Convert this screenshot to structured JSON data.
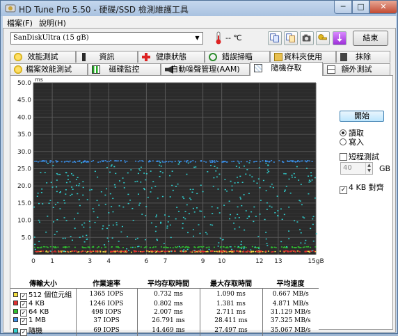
{
  "window": {
    "title": "HD Tune Pro 5.50 - 硬碟/SSD 檢測維護工具",
    "min": "─",
    "max": "□",
    "close": "✕"
  },
  "menu": [
    "檔案(F)",
    "說明(H)"
  ],
  "toolbar": {
    "drive": "SanDiskUltra (15 gB)",
    "temperature": "-- ℃",
    "exit": "結束",
    "icons": [
      "copy-icon",
      "copy-info-icon",
      "camera-icon",
      "settings-key-icon",
      "save-icon"
    ]
  },
  "tabs_top": [
    "效能測試",
    "資訊",
    "健康狀態",
    "錯誤掃瞄",
    "資料夾使用",
    "抹除"
  ],
  "tabs_bottom": [
    "檔案效能測試",
    "磁碟監控",
    "自動噪聲管理(AAM)",
    "隨機存取",
    "額外測試"
  ],
  "active_tab": "隨機存取",
  "controls": {
    "start": "開始",
    "read": "讀取",
    "write": "寫入",
    "short_test": "短程測試",
    "gb_value": "40",
    "gb_unit": "GB",
    "align": "4 KB 對齊"
  },
  "chart_data": {
    "type": "scatter",
    "ylabel": "ms",
    "xlabel_unit": "gB",
    "ylim": [
      0,
      50
    ],
    "xlim": [
      0,
      15
    ],
    "y_ticks": [
      "50.0",
      "45.0",
      "40.0",
      "35.0",
      "30.0",
      "25.0",
      "20.0",
      "15.0",
      "10.0",
      "5.0"
    ],
    "x_ticks": [
      "0",
      "1",
      "3",
      "4",
      "6",
      "7",
      "9",
      "10",
      "12",
      "13",
      "15gB"
    ],
    "grid": true,
    "series": [
      {
        "name": "512 個位元組",
        "color": "#f5e040",
        "avg_ms": 0.732
      },
      {
        "name": "4 KB",
        "color": "#e03030",
        "avg_ms": 0.802
      },
      {
        "name": "64 KB",
        "color": "#30c030",
        "avg_ms": 2.007
      },
      {
        "name": "1 MB",
        "color": "#3a8fe8",
        "avg_ms": 26.791
      },
      {
        "name": "隨機",
        "color": "#30d0d0",
        "avg_ms": 14.469
      }
    ]
  },
  "results": {
    "headers": [
      "傳輸大小",
      "作業速率",
      "平均存取時間",
      "最大存取時間",
      "平均速度"
    ],
    "rows": [
      {
        "label": "512 個位元組",
        "color": "#f5e040",
        "iops": "1365 IOPS",
        "avg": "0.732 ms",
        "max": "1.090 ms",
        "speed": "0.667 MB/s"
      },
      {
        "label": "4 KB",
        "color": "#e03030",
        "iops": "1246 IOPS",
        "avg": "0.802 ms",
        "max": "1.381 ms",
        "speed": "4.871 MB/s"
      },
      {
        "label": "64 KB",
        "color": "#30c030",
        "iops": "498 IOPS",
        "avg": "2.007 ms",
        "max": "2.711 ms",
        "speed": "31.129 MB/s"
      },
      {
        "label": "1 MB",
        "color": "#3a8fe8",
        "iops": "37 IOPS",
        "avg": "26.791 ms",
        "max": "28.411 ms",
        "speed": "37.325 MB/s"
      },
      {
        "label": "隨機",
        "color": "#30d0d0",
        "iops": "69 IOPS",
        "avg": "14.469 ms",
        "max": "27.497 ms",
        "speed": "35.067 MB/s"
      }
    ]
  }
}
